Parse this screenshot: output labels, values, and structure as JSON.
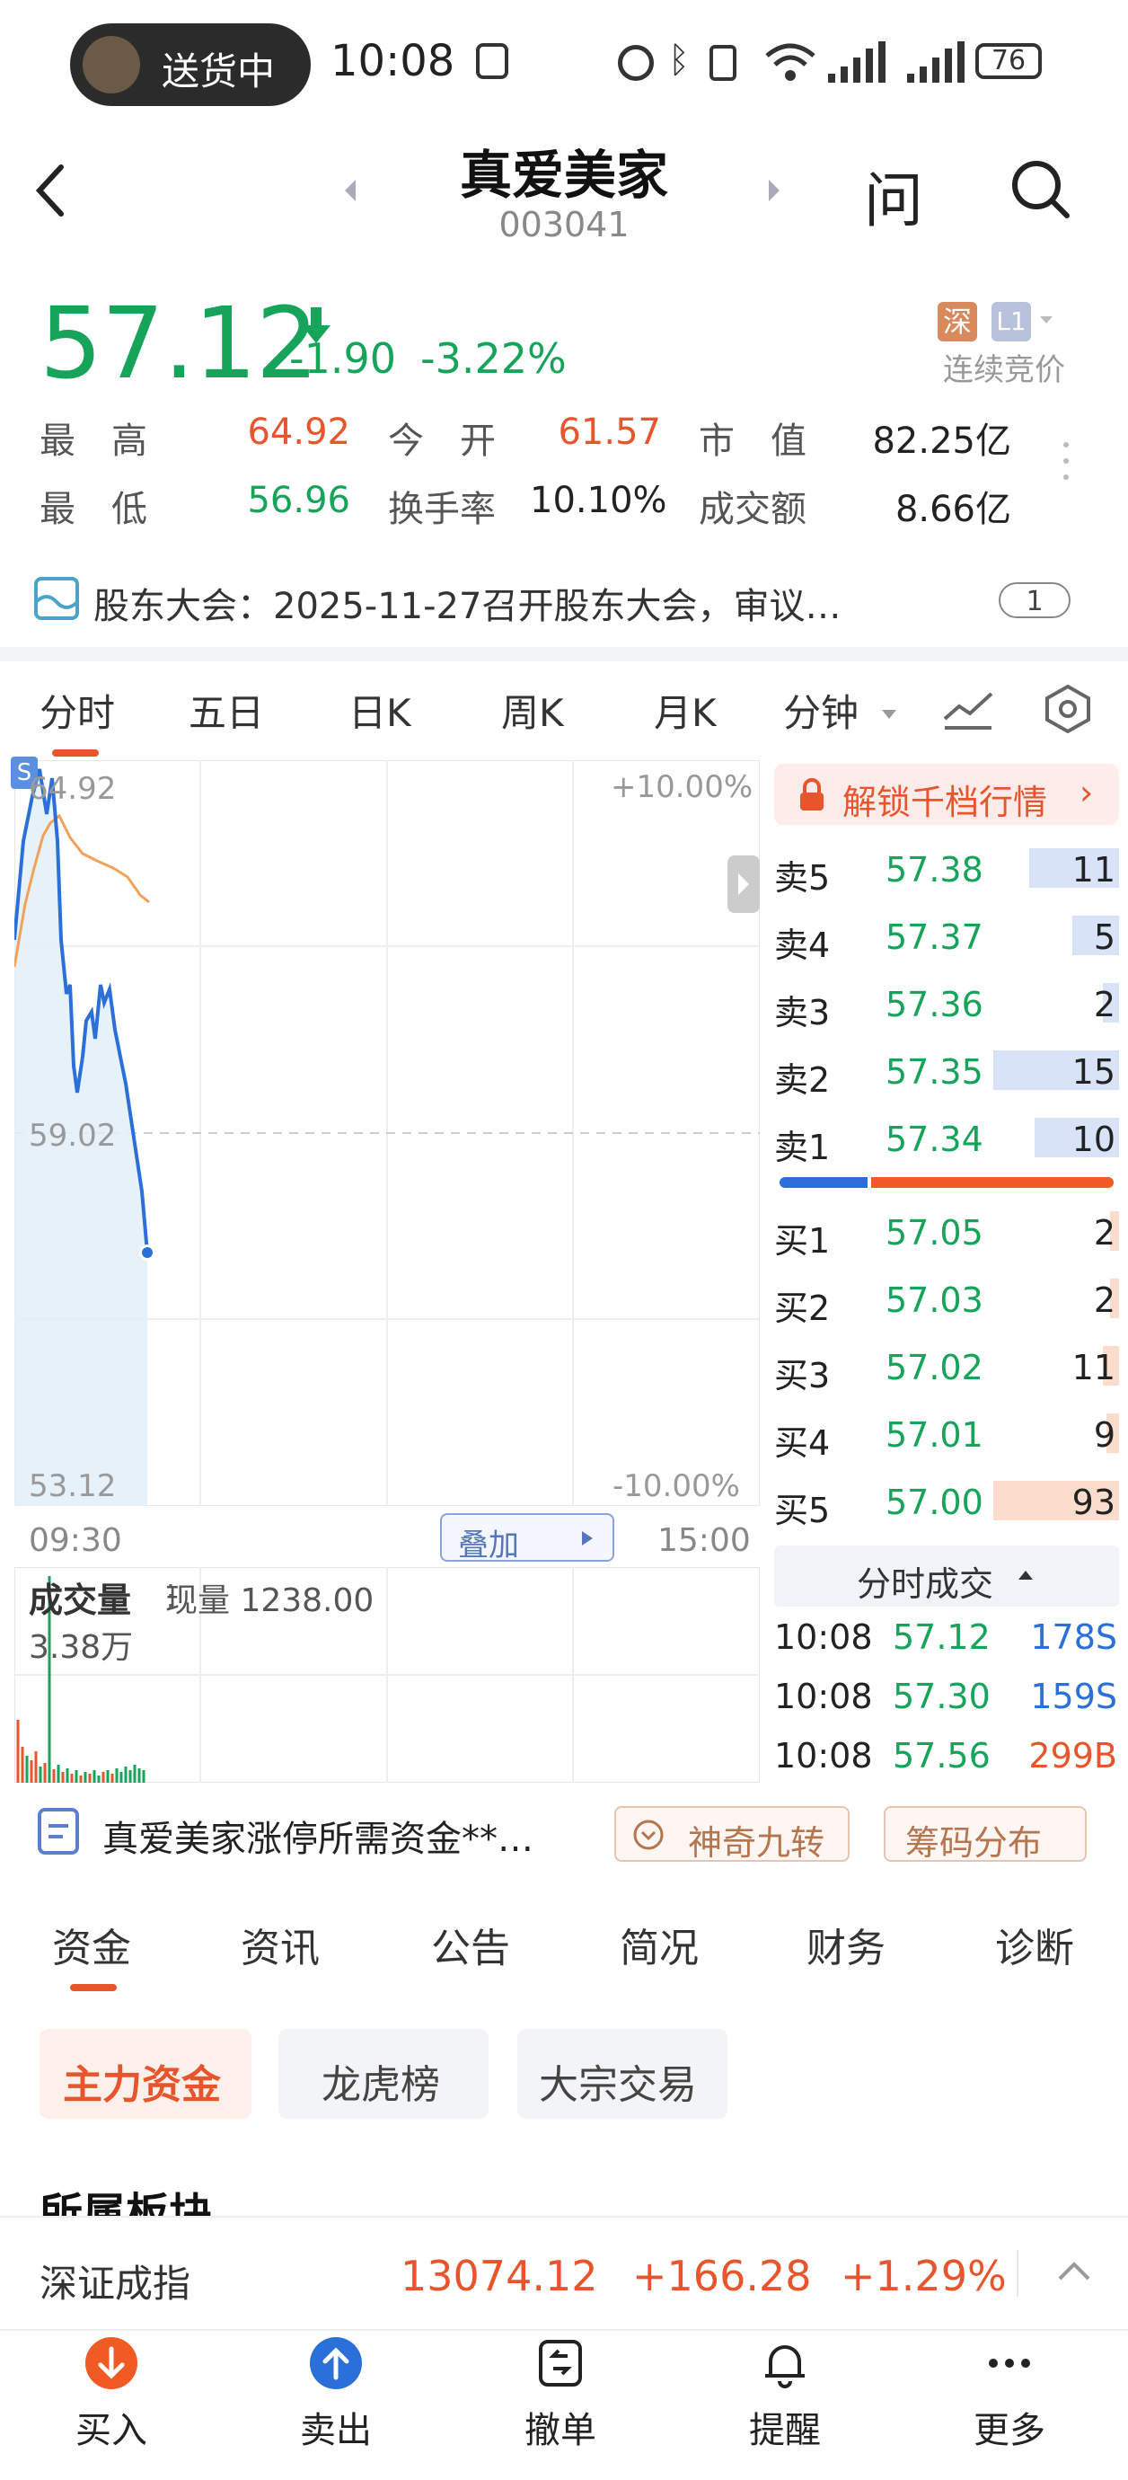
{
  "status_bar": {
    "pill_label": "送货中",
    "time": "10:08",
    "battery": "76"
  },
  "header": {
    "name": "真爱美家",
    "code": "003041",
    "ask_icon_label": "问"
  },
  "quote": {
    "price": "57.12",
    "change": "-1.90",
    "change_pct": "-3.22%",
    "exchange_tag": "深",
    "level_tag": "L1",
    "session": "连续竞价",
    "stats": [
      {
        "label": "最　高",
        "value": "64.92"
      },
      {
        "label": "今　开",
        "value": "61.57"
      },
      {
        "label": "市　值",
        "value": "82.25亿"
      },
      {
        "label": "最　低",
        "value": "56.96"
      },
      {
        "label": "换手率",
        "value": "10.10%"
      },
      {
        "label": "成交额",
        "value": "8.66亿"
      }
    ]
  },
  "notice": {
    "text": "股东大会：2025-11-27召开股东大会，审议…",
    "count": "1"
  },
  "chart_tabs": [
    "分时",
    "五日",
    "日K",
    "周K",
    "月K",
    "分钟"
  ],
  "intraday": {
    "high_label": "64.92",
    "mid_label": "59.02",
    "low_label": "53.12",
    "up_pct": "+10.00%",
    "down_pct": "-10.00%",
    "start_time": "09:30",
    "end_time": "15:00",
    "overlay_btn": "叠加",
    "s_badge": "S"
  },
  "volume": {
    "title": "成交量",
    "current_label": "现量 1238.00",
    "max_label": "3.38万"
  },
  "order_book": {
    "unlock": "解锁千档行情",
    "asks": [
      {
        "label": "卖5",
        "price": "57.38",
        "vol": "11"
      },
      {
        "label": "卖4",
        "price": "57.37",
        "vol": "5"
      },
      {
        "label": "卖3",
        "price": "57.36",
        "vol": "2"
      },
      {
        "label": "卖2",
        "price": "57.35",
        "vol": "15"
      },
      {
        "label": "卖1",
        "price": "57.34",
        "vol": "10"
      }
    ],
    "bids": [
      {
        "label": "买1",
        "price": "57.05",
        "vol": "2"
      },
      {
        "label": "买2",
        "price": "57.03",
        "vol": "2"
      },
      {
        "label": "买3",
        "price": "57.02",
        "vol": "11"
      },
      {
        "label": "买4",
        "price": "57.01",
        "vol": "9"
      },
      {
        "label": "买5",
        "price": "57.00",
        "vol": "93"
      }
    ],
    "trades_title": "分时成交",
    "trades": [
      {
        "time": "10:08",
        "price": "57.12",
        "vol": "178S"
      },
      {
        "time": "10:08",
        "price": "57.30",
        "vol": "159S"
      },
      {
        "time": "10:08",
        "price": "57.56",
        "vol": "299B"
      }
    ]
  },
  "promo": {
    "text": "真爱美家涨停所需资金**…",
    "btn1": "神奇九转",
    "btn2": "筹码分布"
  },
  "bottom_tabs": [
    "资金",
    "资讯",
    "公告",
    "简况",
    "财务",
    "诊断"
  ],
  "sub_tabs": [
    "主力资金",
    "龙虎榜",
    "大宗交易"
  ],
  "section_title": "所属板块",
  "index_bar": {
    "name": "深证成指",
    "value": "13074.12",
    "change": "+166.28",
    "pct": "+1.29%"
  },
  "nav": [
    "买入",
    "卖出",
    "撤单",
    "提醒",
    "更多"
  ]
}
